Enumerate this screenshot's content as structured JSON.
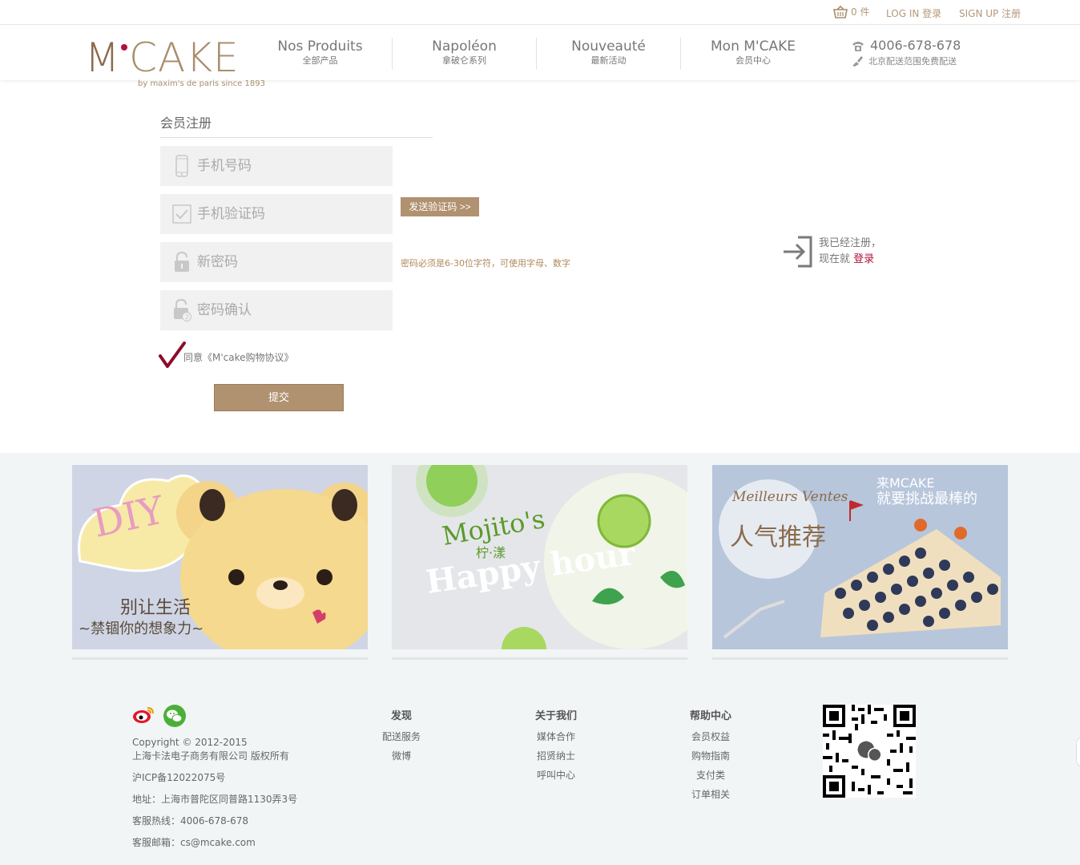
{
  "topbar": {
    "cart_count": "0 件",
    "login": "LOG IN 登录",
    "signup": "SIGN UP 注册"
  },
  "logo": {
    "brand_m": "M",
    "brand_rest": "CAKE",
    "tagline": "by maxim's de paris since 1893"
  },
  "nav": [
    {
      "en": "Nos Produits",
      "cn": "全部产品"
    },
    {
      "en": "Napoléon",
      "cn": "拿破仑系列"
    },
    {
      "en": "Nouveauté",
      "cn": "最新活动"
    },
    {
      "en": "Mon M'CAKE",
      "cn": "会员中心"
    }
  ],
  "contact": {
    "phone": "4006-678-678",
    "shipping": "北京配送范围免费配送"
  },
  "form": {
    "title": "会员注册",
    "phone_placeholder": "手机号码",
    "code_placeholder": "手机验证码",
    "password_placeholder": "新密码",
    "confirm_placeholder": "密码确认",
    "send_code": "发送验证码 >>",
    "password_hint": "密码必须是6-30位字符，可使用字母、数字",
    "agree_text": "同意《M'cake购物协议》",
    "submit": "提交"
  },
  "already": {
    "line1": "我已经注册，",
    "line2_prefix": "现在就 ",
    "login_link": "登录"
  },
  "banners": {
    "b1_line1": "别让生活",
    "b1_line2": "~禁锢你的想象力~",
    "b1_badge": "DIY",
    "b2_title": "Mojito's",
    "b2_cn": "柠·漾",
    "b2_sub": "Happy hour",
    "b3_fr": "Meilleurs Ventes",
    "b3_cn": "人气推荐",
    "b3_top1": "来MCAKE",
    "b3_top2": "就要挑战最棒的"
  },
  "footer": {
    "copyright": "Copyright © 2012-2015",
    "company": "上海卡法电子商务有限公司 版权所有",
    "icp": "沪ICP备12022075号",
    "address": "地址：上海市普陀区同普路1130弄3号",
    "hotline": "客服热线：4006-678-678",
    "email": "客服邮箱：cs@mcake.com",
    "columns": [
      {
        "title": "发现",
        "links": [
          "配送服务",
          "微博"
        ]
      },
      {
        "title": "关于我们",
        "links": [
          "媒体合作",
          "招贤纳士",
          "呼叫中心"
        ]
      },
      {
        "title": "帮助中心",
        "links": [
          "会员权益",
          "购物指南",
          "支付类",
          "订单相关"
        ]
      }
    ]
  },
  "colors": {
    "accent": "#b09170",
    "brand_red": "#b0133d",
    "gray_bg": "#f2f5f6"
  },
  "icons": [
    "cart-icon",
    "phone-icon",
    "truck-icon",
    "mobile-icon",
    "check-box-icon",
    "lock-icon",
    "lock-confirm-icon",
    "checkmark-icon",
    "login-arrow-icon",
    "weibo-icon",
    "wechat-icon",
    "qr-code-icon"
  ]
}
